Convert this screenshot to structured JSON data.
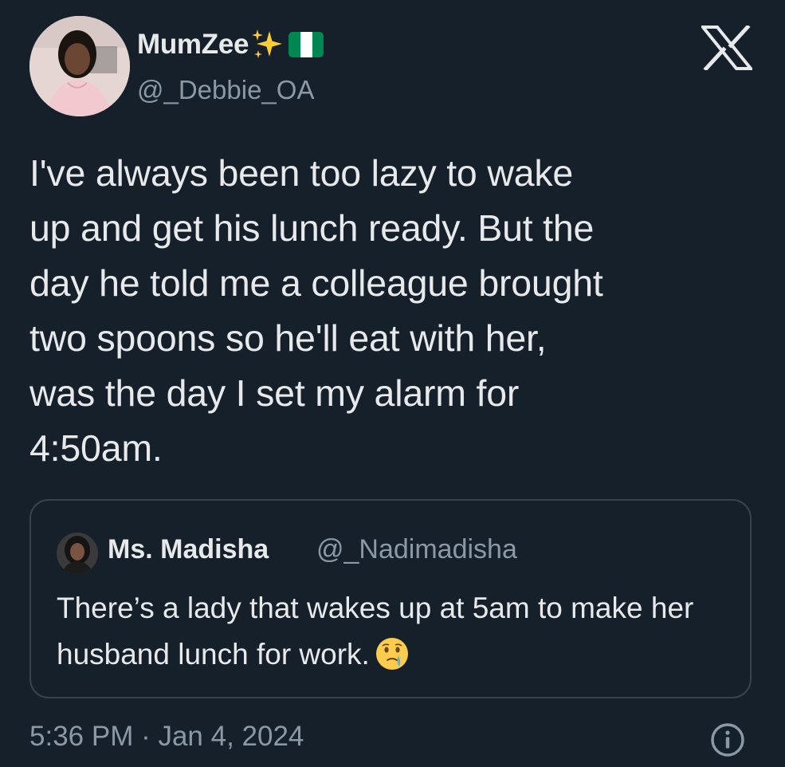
{
  "author": {
    "display_name": "MumZee",
    "handle": "@_Debbie_OA",
    "badges": [
      "sparkles-icon",
      "nigeria-flag-icon"
    ]
  },
  "tweet": {
    "text": "I've always been too lazy to wake\nup and get his lunch ready. But the\nday he told me a colleague brought\ntwo spoons so he'll eat with her,\nwas the day I set my alarm for\n4:50am."
  },
  "quoted_tweet": {
    "display_name": "Ms. Madisha",
    "handle": "@_Nadimadisha",
    "text": "There’s a lady that wakes up at 5am to make her husband lunch for work."
  },
  "timestamp": "5:36 PM · Jan 4, 2024",
  "colors": {
    "background": "#15202b",
    "primary_text": "#e7e9ea",
    "secondary_text": "#8b98a5",
    "border": "#38444d",
    "flag_green": "#008751",
    "flag_white": "#ffffff",
    "sparkle": "#ffcc33"
  },
  "icons": {
    "logo": "x-logo-icon",
    "info": "info-icon"
  }
}
